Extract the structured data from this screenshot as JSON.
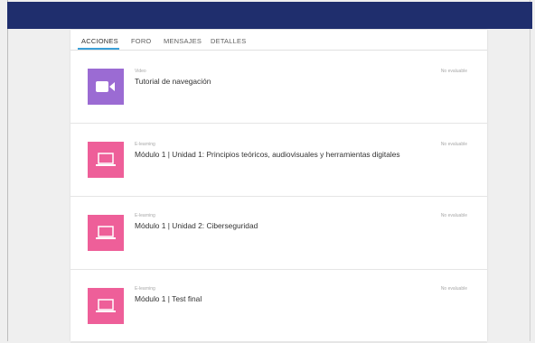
{
  "tabs": [
    {
      "label": "ACCIONES",
      "active": true
    },
    {
      "label": "FORO",
      "active": false
    },
    {
      "label": "MENSAJES",
      "active": false
    },
    {
      "label": "DETALLES",
      "active": false
    }
  ],
  "colors": {
    "topbar": "#1f2e6d",
    "tab_accent": "#3aa0d8",
    "video_thumb": "#9b6bd3",
    "elearning_thumb": "#ee5f99"
  },
  "activities": [
    {
      "type": "Video",
      "title": "Tutorial de navegación",
      "status": "No evaluable",
      "icon": "video-camera-icon"
    },
    {
      "type": "E-learning",
      "title": "Módulo 1 | Unidad 1: Principios teóricos, audiovisuales y herramientas digitales",
      "status": "No evaluable",
      "icon": "laptop-icon"
    },
    {
      "type": "E-learning",
      "title": "Módulo 1 | Unidad 2: Ciberseguridad",
      "status": "No evaluable",
      "icon": "laptop-icon"
    },
    {
      "type": "E-learning",
      "title": "Módulo 1 | Test final",
      "status": "No evaluable",
      "icon": "laptop-icon"
    }
  ]
}
